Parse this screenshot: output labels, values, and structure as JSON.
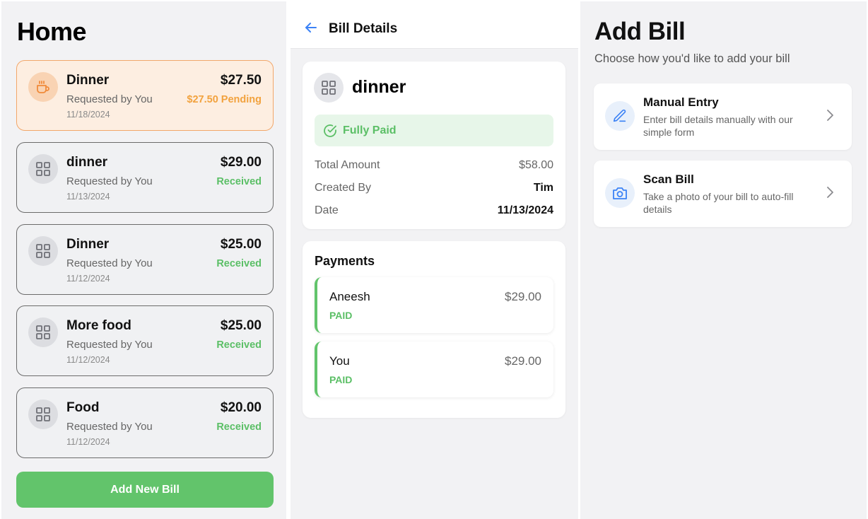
{
  "home": {
    "title": "Home",
    "bills": [
      {
        "name": "Dinner",
        "requested_by": "Requested by You",
        "date": "11/18/2024",
        "amount": "$27.50",
        "status": "$27.50 Pending",
        "state": "pending",
        "icon": "coffee-icon"
      },
      {
        "name": "dinner",
        "requested_by": "Requested by You",
        "date": "11/13/2024",
        "amount": "$29.00",
        "status": "Received",
        "state": "received",
        "icon": "grid-icon"
      },
      {
        "name": "Dinner",
        "requested_by": "Requested by You",
        "date": "11/12/2024",
        "amount": "$25.00",
        "status": "Received",
        "state": "received",
        "icon": "grid-icon"
      },
      {
        "name": "More food",
        "requested_by": "Requested by You",
        "date": "11/12/2024",
        "amount": "$25.00",
        "status": "Received",
        "state": "received",
        "icon": "grid-icon"
      },
      {
        "name": "Food",
        "requested_by": "Requested by You",
        "date": "11/12/2024",
        "amount": "$20.00",
        "status": "Received",
        "state": "received",
        "icon": "grid-icon"
      }
    ],
    "add_button": "Add New Bill"
  },
  "details": {
    "header_title": "Bill Details",
    "bill_name": "dinner",
    "status_banner": "Fully Paid",
    "rows": {
      "total_label": "Total Amount",
      "total_value": "$58.00",
      "created_label": "Created By",
      "created_value": "Tim",
      "date_label": "Date",
      "date_value": "11/13/2024"
    },
    "payments_title": "Payments",
    "payments": [
      {
        "name": "Aneesh",
        "amount": "$29.00",
        "status": "PAID"
      },
      {
        "name": "You",
        "amount": "$29.00",
        "status": "PAID"
      }
    ]
  },
  "add_bill": {
    "title": "Add Bill",
    "subtitle": "Choose how you'd like to add your bill",
    "options": [
      {
        "title": "Manual Entry",
        "description": "Enter bill details manually with our simple form",
        "icon": "pencil-icon"
      },
      {
        "title": "Scan Bill",
        "description": "Take a photo of your bill to auto-fill details",
        "icon": "camera-icon"
      }
    ]
  },
  "colors": {
    "accent_green": "#62c46b",
    "pending_orange": "#f2a23e",
    "link_blue": "#3b82f6",
    "background": "#f2f2f4"
  }
}
